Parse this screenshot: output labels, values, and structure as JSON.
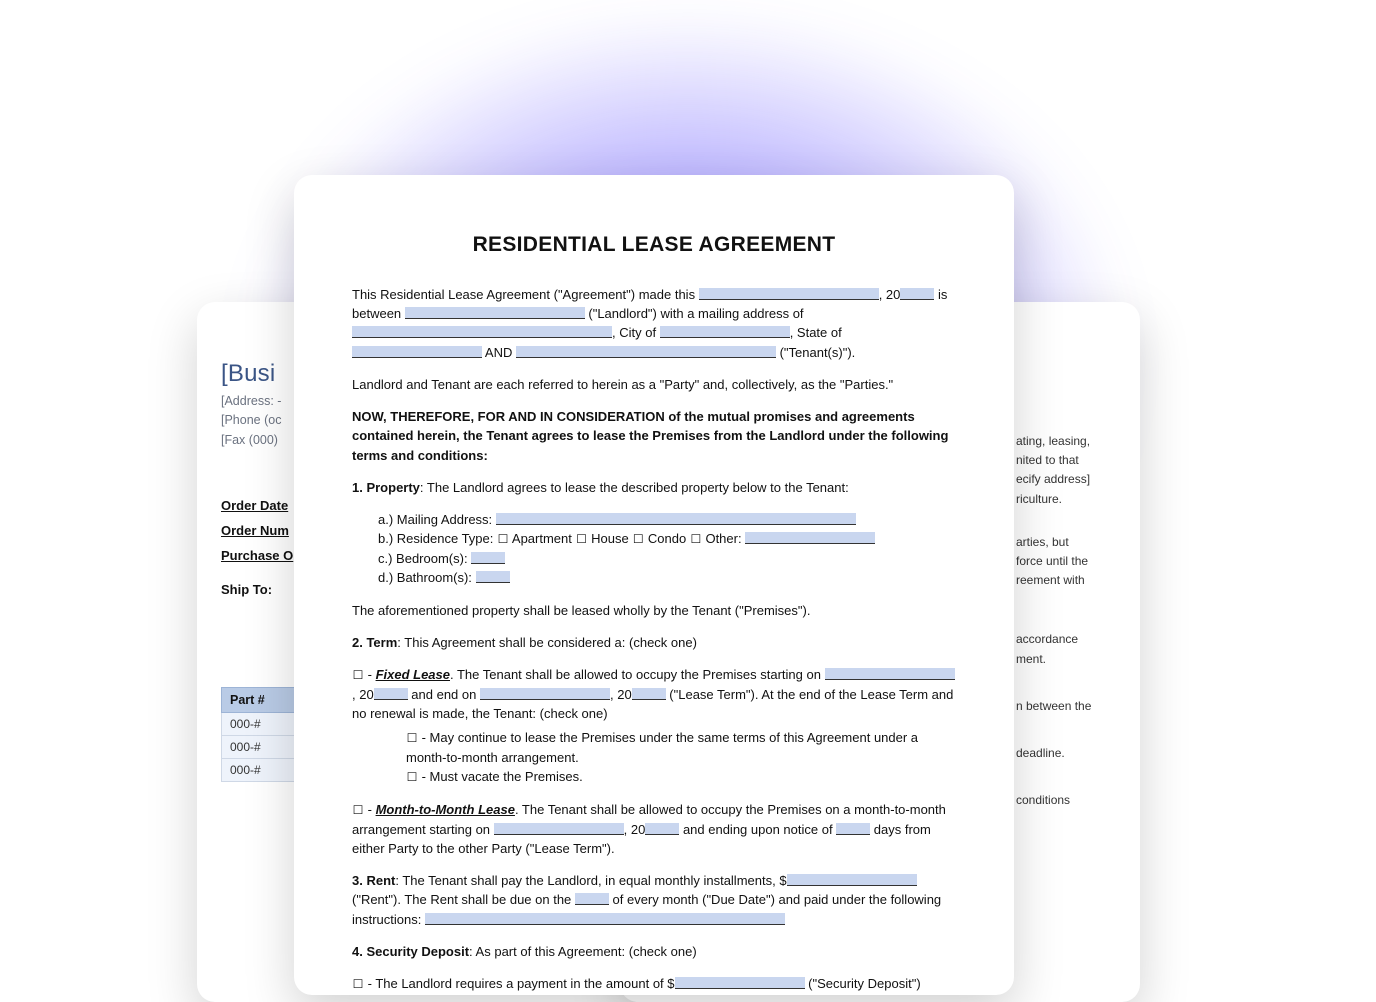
{
  "back_left": {
    "biz_title": "[Busi",
    "addr": "[Address: -",
    "phone": "[Phone (oc",
    "fax": "[Fax (000)",
    "order_date": "Order Date",
    "order_num": "Order Num",
    "po": "Purchase O",
    "ship_to": "Ship To:",
    "table_header": "Part #",
    "rows": [
      "000-#",
      "000-#",
      "000-#"
    ]
  },
  "back_right": {
    "l1": "ating, leasing,",
    "l2": "nited to that",
    "l3": "ecify address]",
    "l4": "riculture.",
    "l5": "arties, but",
    "l6": "force until the",
    "l7": "reement with",
    "l8": "accordance",
    "l9": "ment.",
    "l10": "n between the",
    "l11": "deadline.",
    "l12": "conditions"
  },
  "front": {
    "title": "RESIDENTIAL LEASE AGREEMENT",
    "intro_a": "This Residential Lease Agreement (\"Agreement\") made this ",
    "intro_b": ", 20",
    "intro_c": " is between ",
    "intro_d": " (\"Landlord\") with a mailing address of ",
    "intro_e": ", City of ",
    "intro_f": ", State of ",
    "intro_g": " AND ",
    "intro_h": " (\"Tenant(s)\").",
    "parties": "Landlord and Tenant are each referred to herein as a \"Party\" and, collectively, as the \"Parties.\"",
    "recital": "NOW, THEREFORE, FOR AND IN CONSIDERATION of the mutual promises and agreements contained herein, the Tenant agrees to lease the Premises from the Landlord under the following terms and conditions:",
    "s1_label": "1. Property",
    "s1_text": ": The Landlord agrees to lease the described property below to the Tenant:",
    "s1_a": "a.)  Mailing Address: ",
    "s1_b_pre": "b.)  Residence Type: ",
    "res_apartment": " Apartment ",
    "res_house": " House ",
    "res_condo": " Condo ",
    "res_other": " Other: ",
    "s1_c": "c.)  Bedroom(s): ",
    "s1_d": "d.)  Bathroom(s): ",
    "s1_footer": "The aforementioned property shall be leased wholly by the Tenant (\"Premises\").",
    "s2_label": "2. Term",
    "s2_text": ": This Agreement shall be considered a: (check one)",
    "fixed_label": "Fixed Lease",
    "fixed_a": ". The Tenant shall be allowed to occupy the Premises starting on ",
    "fixed_b": ", 20",
    "fixed_c": " and end on ",
    "fixed_d": ", 20",
    "fixed_e": " (\"Lease Term\"). At the end of the Lease Term and no renewal is made, the Tenant: (check one)",
    "fixed_opt1": " - May continue to lease the Premises under the same terms of this Agreement under a month-to-month arrangement.",
    "fixed_opt2": " - Must vacate the Premises.",
    "m2m_label": "Month-to-Month Lease",
    "m2m_a": ". The Tenant shall be allowed to occupy the Premises on a month-to-month arrangement starting on ",
    "m2m_b": ", 20",
    "m2m_c": " and ending upon notice of ",
    "m2m_d": " days from either Party to the other Party (\"Lease Term\").",
    "s3_label": "3. Rent",
    "s3_a": ": The Tenant shall pay the Landlord, in equal monthly installments, $",
    "s3_b": " (\"Rent\"). The Rent shall be due on the ",
    "s3_c": " of every month (\"Due Date\") and paid under the following instructions: ",
    "s4_label": "4. Security Deposit",
    "s4_text": ": As part of this Agreement: (check one)",
    "s4_opt_a": " - The Landlord requires a payment in the amount of $",
    "s4_opt_b": " (\"Security Deposit\")"
  }
}
